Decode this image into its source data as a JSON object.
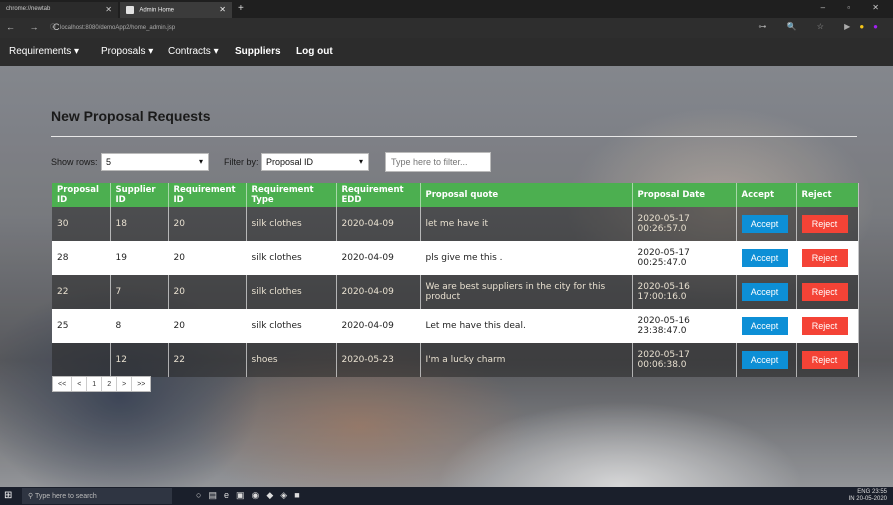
{
  "browser": {
    "tabs": [
      {
        "label": "chrome://newtab"
      },
      {
        "label": "Admin Home"
      }
    ],
    "new_tab": "+",
    "window_controls": "–  ▫  ✕",
    "url": "localhost:8080/demoApp2/home_admin.jsp",
    "nav_glyphs": "← → C",
    "addr_right_glyphs": "⊶ 🔍 ☆ ▶"
  },
  "nav": {
    "items": [
      {
        "label": "Requirements ▾"
      },
      {
        "label": "Proposals ▾"
      },
      {
        "label": "Contracts ▾"
      },
      {
        "label": "Suppliers"
      },
      {
        "label": "Log out"
      }
    ]
  },
  "page": {
    "title": "New Proposal Requests",
    "show_rows_label": "Show rows:",
    "show_rows_value": "5",
    "filter_by_label": "Filter by:",
    "filter_by_value": "Proposal ID",
    "filter_placeholder": "Type here to filter..."
  },
  "table": {
    "headers": [
      "Proposal ID",
      "Supplier ID",
      "Requirement ID",
      "Requirement Type",
      "Requirement EDD",
      "Proposal quote",
      "Proposal Date",
      "Accept",
      "Reject"
    ],
    "accept_label": "Accept",
    "reject_label": "Reject",
    "rows": [
      [
        "30",
        "18",
        "20",
        "silk clothes",
        "2020-04-09",
        "let me have it",
        "2020-05-17 00:26:57.0"
      ],
      [
        "28",
        "19",
        "20",
        "silk clothes",
        "2020-04-09",
        "pls give me this .",
        "2020-05-17 00:25:47.0"
      ],
      [
        "22",
        "7",
        "20",
        "silk clothes",
        "2020-04-09",
        "We are best suppliers in the city for this product",
        "2020-05-16 17:00:16.0"
      ],
      [
        "25",
        "8",
        "20",
        "silk clothes",
        "2020-04-09",
        "Let me have this deal.",
        "2020-05-16 23:38:47.0"
      ],
      [
        "",
        "12",
        "22",
        "shoes",
        "2020-05-23",
        "I'm a lucky charm",
        "2020-05-17 00:06:38.0"
      ]
    ]
  },
  "pager": {
    "items": [
      "<<",
      "<",
      "1",
      "2",
      ">",
      ">>"
    ]
  },
  "taskbar": {
    "search_placeholder": "Type here to search",
    "tray_lang": "ENG",
    "tray_region": "IN",
    "time": "23:55",
    "date": "20-05-2020"
  }
}
